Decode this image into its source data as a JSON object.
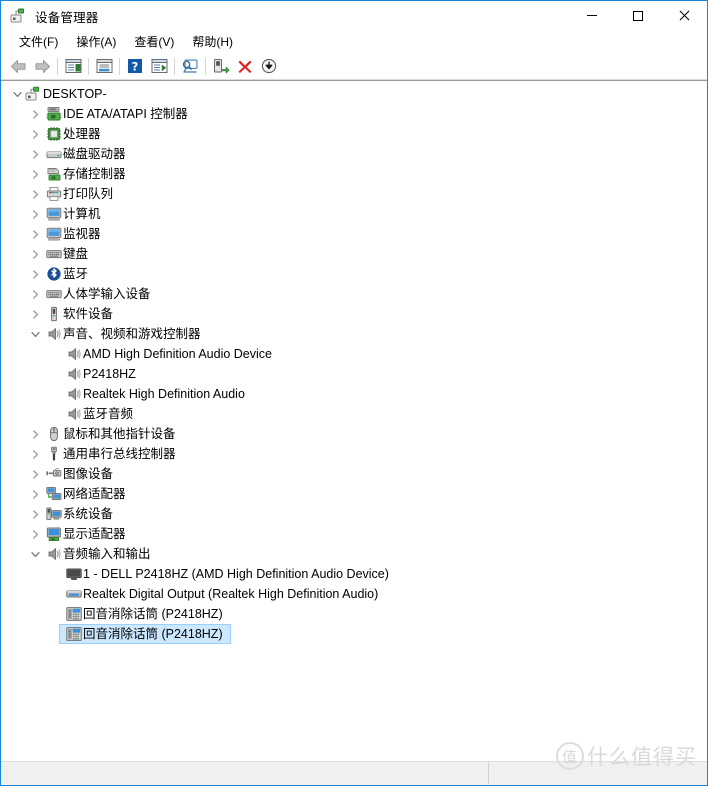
{
  "window": {
    "title": "设备管理器",
    "icon": "device-manager-icon",
    "controls": {
      "minimize": "最小化",
      "maximize": "最大化",
      "close": "关闭"
    }
  },
  "menubar": {
    "items": [
      {
        "label": "文件(F)",
        "name": "menu-file"
      },
      {
        "label": "操作(A)",
        "name": "menu-action"
      },
      {
        "label": "查看(V)",
        "name": "menu-view"
      },
      {
        "label": "帮助(H)",
        "name": "menu-help"
      }
    ]
  },
  "toolbar": {
    "buttons": [
      {
        "name": "back-icon",
        "type": "arrow-left"
      },
      {
        "name": "forward-icon",
        "type": "arrow-right"
      },
      {
        "name": "separator",
        "type": "sep"
      },
      {
        "name": "show-hide-console-tree-icon",
        "type": "tree-pane"
      },
      {
        "name": "separator",
        "type": "sep"
      },
      {
        "name": "properties-icon",
        "type": "properties"
      },
      {
        "name": "separator",
        "type": "sep"
      },
      {
        "name": "help-icon",
        "type": "help"
      },
      {
        "name": "update-driver-icon",
        "type": "update-driver"
      },
      {
        "name": "separator",
        "type": "sep"
      },
      {
        "name": "scan-hardware-changes-icon",
        "type": "scan"
      },
      {
        "name": "separator",
        "type": "sep"
      },
      {
        "name": "enable-device-icon",
        "type": "enable"
      },
      {
        "name": "uninstall-device-icon",
        "type": "uninstall"
      },
      {
        "name": "disable-device-icon",
        "type": "disable"
      }
    ]
  },
  "tree": {
    "nodes": [
      {
        "label": "DESKTOP-",
        "level": 0,
        "icon": "computer-root-icon",
        "state": "expanded",
        "selected": false
      },
      {
        "label": "IDE ATA/ATAPI 控制器",
        "level": 1,
        "icon": "ide-controller-icon",
        "state": "collapsed",
        "selected": false
      },
      {
        "label": "处理器",
        "level": 1,
        "icon": "processor-icon",
        "state": "collapsed",
        "selected": false
      },
      {
        "label": "磁盘驱动器",
        "level": 1,
        "icon": "disk-drive-icon",
        "state": "collapsed",
        "selected": false
      },
      {
        "label": "存储控制器",
        "level": 1,
        "icon": "storage-controller-icon",
        "state": "collapsed",
        "selected": false
      },
      {
        "label": "打印队列",
        "level": 1,
        "icon": "print-queue-icon",
        "state": "collapsed",
        "selected": false
      },
      {
        "label": "计算机",
        "level": 1,
        "icon": "computer-icon",
        "state": "collapsed",
        "selected": false
      },
      {
        "label": "监视器",
        "level": 1,
        "icon": "monitor-icon",
        "state": "collapsed",
        "selected": false
      },
      {
        "label": "键盘",
        "level": 1,
        "icon": "keyboard-icon",
        "state": "collapsed",
        "selected": false
      },
      {
        "label": "蓝牙",
        "level": 1,
        "icon": "bluetooth-icon",
        "state": "collapsed",
        "selected": false
      },
      {
        "label": "人体学输入设备",
        "level": 1,
        "icon": "hid-icon",
        "state": "collapsed",
        "selected": false
      },
      {
        "label": "软件设备",
        "level": 1,
        "icon": "software-device-icon",
        "state": "collapsed",
        "selected": false
      },
      {
        "label": "声音、视频和游戏控制器",
        "level": 1,
        "icon": "speaker-icon",
        "state": "expanded",
        "selected": false
      },
      {
        "label": "AMD High Definition Audio Device",
        "level": 2,
        "icon": "speaker-icon",
        "state": "leaf",
        "selected": false
      },
      {
        "label": "P2418HZ",
        "level": 2,
        "icon": "speaker-icon",
        "state": "leaf",
        "selected": false
      },
      {
        "label": "Realtek High Definition Audio",
        "level": 2,
        "icon": "speaker-icon",
        "state": "leaf",
        "selected": false
      },
      {
        "label": "蓝牙音频",
        "level": 2,
        "icon": "speaker-icon",
        "state": "leaf",
        "selected": false
      },
      {
        "label": "鼠标和其他指针设备",
        "level": 1,
        "icon": "mouse-icon",
        "state": "collapsed",
        "selected": false
      },
      {
        "label": "通用串行总线控制器",
        "level": 1,
        "icon": "usb-icon",
        "state": "collapsed",
        "selected": false
      },
      {
        "label": "图像设备",
        "level": 1,
        "icon": "camera-icon",
        "state": "collapsed",
        "selected": false
      },
      {
        "label": "网络适配器",
        "level": 1,
        "icon": "network-adapter-icon",
        "state": "collapsed",
        "selected": false
      },
      {
        "label": "系统设备",
        "level": 1,
        "icon": "system-device-icon",
        "state": "collapsed",
        "selected": false
      },
      {
        "label": "显示适配器",
        "level": 1,
        "icon": "display-adapter-icon",
        "state": "collapsed",
        "selected": false
      },
      {
        "label": "音频输入和输出",
        "level": 1,
        "icon": "speaker-icon",
        "state": "expanded",
        "selected": false
      },
      {
        "label": "1 - DELL P2418HZ (AMD High Definition Audio Device)",
        "level": 2,
        "icon": "monitor-dark-icon",
        "state": "leaf",
        "selected": false
      },
      {
        "label": "Realtek Digital Output (Realtek High Definition Audio)",
        "level": 2,
        "icon": "audio-output-icon",
        "state": "leaf",
        "selected": false
      },
      {
        "label": "回音消除话筒 (P2418HZ)",
        "level": 2,
        "icon": "microphone-device-icon",
        "state": "leaf",
        "selected": false
      },
      {
        "label": "回音消除话筒 (P2418HZ)",
        "level": 2,
        "icon": "microphone-device-icon",
        "state": "leaf",
        "selected": true
      }
    ]
  },
  "statusbar": {
    "text": ""
  },
  "watermark": {
    "mark": "值",
    "text": "什么值得买"
  },
  "colors": {
    "window_border": "#1883d7",
    "selection_fill": "#cce8ff",
    "selection_border": "#9cd0fb",
    "chevron": "#8a8a8a",
    "statusbar_bg": "#f0f0f0"
  }
}
